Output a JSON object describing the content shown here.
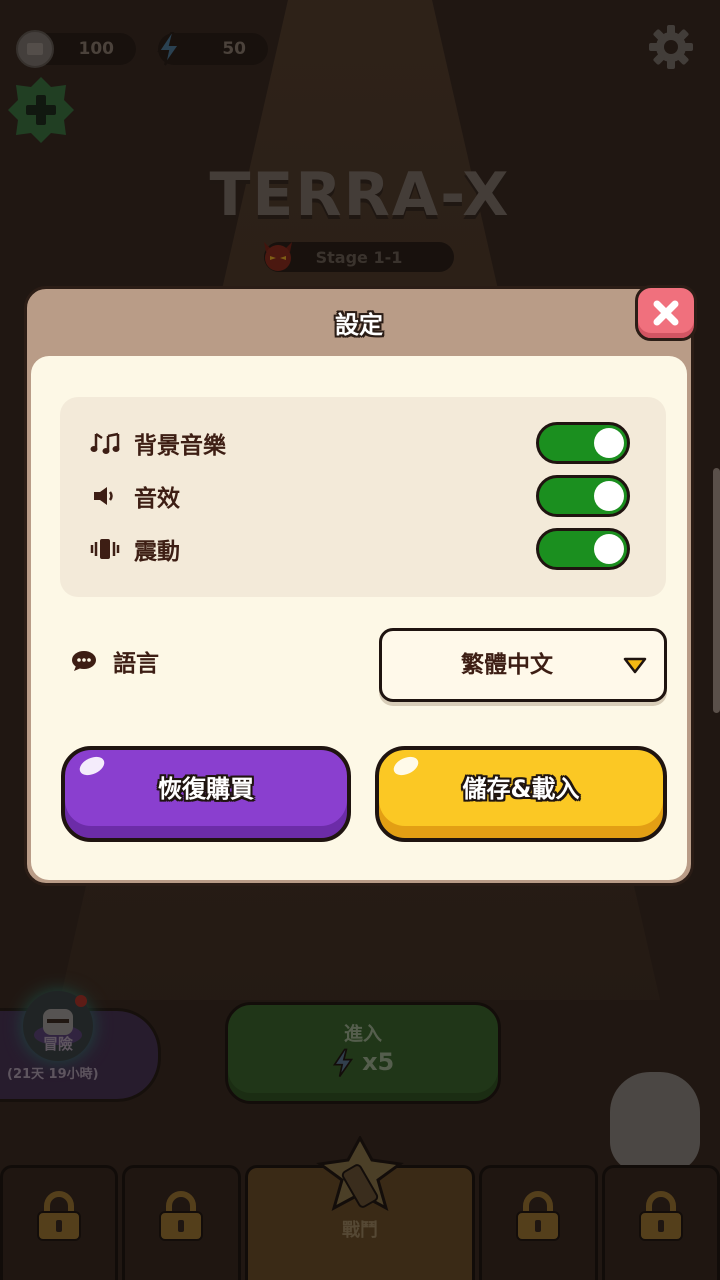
{
  "hud": {
    "coins": "100",
    "energy": "50",
    "coin_icon": "coin-icon",
    "energy_icon": "lightning-icon",
    "settings_icon": "gear-icon",
    "add_icon": "plus-icon"
  },
  "game": {
    "title": "TERRA-X",
    "stage": "Stage 1-1"
  },
  "adventure": {
    "label": "冒險",
    "timer": "(21天 19小時)"
  },
  "enter_button": {
    "label": "進入",
    "cost": "x5"
  },
  "tabbar": {
    "active_label": "戰鬥",
    "tabs": [
      "locked",
      "locked",
      "battle",
      "locked",
      "locked"
    ]
  },
  "dialog": {
    "title": "設定",
    "close_icon": "close-icon",
    "settings": [
      {
        "icon": "music-icon",
        "label": "背景音樂",
        "enabled": true
      },
      {
        "icon": "speaker-icon",
        "label": "音效",
        "enabled": true
      },
      {
        "icon": "vibration-icon",
        "label": "震動",
        "enabled": true
      }
    ],
    "language": {
      "icon": "chat-bubble-icon",
      "label": "語言",
      "selected": "繁體中文"
    },
    "buttons": {
      "restore": "恢復購買",
      "save_load": "儲存&載入"
    }
  },
  "colors": {
    "toggle_on": "#1b8f1f",
    "restore_button": "#8a3fcf",
    "save_button": "#fbc824",
    "close_button": "#f0707d",
    "dialog_header": "#b99c87",
    "dialog_body": "#fdf8e6",
    "text_dark": "#3d1e14"
  }
}
